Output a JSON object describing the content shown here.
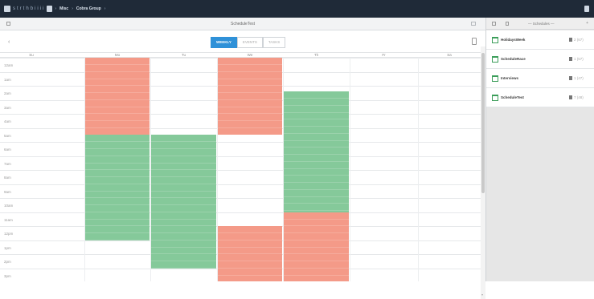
{
  "topbar": {
    "tools": [
      "menu",
      "s",
      "t",
      "r",
      "t",
      "h",
      "b",
      "i",
      "i",
      "i",
      "i"
    ],
    "breadcrumb": [
      "Misc",
      "Cobra Group"
    ],
    "arrow": "›"
  },
  "window": {
    "title": "ScheduleTest",
    "nav_prev": "‹",
    "view_buttons": [
      "WEEKLY",
      "EVENTS",
      "TASKS"
    ],
    "active_view": "WEEKLY"
  },
  "days": [
    "Su",
    "Mo",
    "Tu",
    "We",
    "Th",
    "Fr",
    "Sa"
  ],
  "hours": [
    "12am",
    "1am",
    "2am",
    "3am",
    "4am",
    "5am",
    "6am",
    "7am",
    "8am",
    "9am",
    "10am",
    "11am",
    "12pm",
    "1pm",
    "2pm",
    "3pm"
  ],
  "events": [
    {
      "day": 1,
      "start": 0,
      "end": 5.5,
      "status": "red"
    },
    {
      "day": 1,
      "start": 5.5,
      "end": 13,
      "status": "green"
    },
    {
      "day": 2,
      "start": 5.5,
      "end": 15,
      "status": "green"
    },
    {
      "day": 3,
      "start": 0,
      "end": 5.5,
      "status": "red"
    },
    {
      "day": 3,
      "start": 12,
      "end": 16,
      "status": "red"
    },
    {
      "day": 4,
      "start": 2.4,
      "end": 11,
      "status": "green"
    },
    {
      "day": 4,
      "start": 11,
      "end": 16,
      "status": "red"
    }
  ],
  "colors": {
    "red": "#f49a88",
    "green": "#85c99a",
    "accent": "#2f91d8",
    "topbar": "#1f2a38"
  },
  "sidebar": {
    "title": "— Schedules —",
    "items": [
      {
        "name": "HolidaysWeek",
        "count": "2 (67)"
      },
      {
        "name": "ScheduleRace",
        "count": "1 (57)"
      },
      {
        "name": "Interviews",
        "count": "1 (47)"
      },
      {
        "name": "ScheduleTest",
        "count": "7 (48)"
      }
    ]
  }
}
